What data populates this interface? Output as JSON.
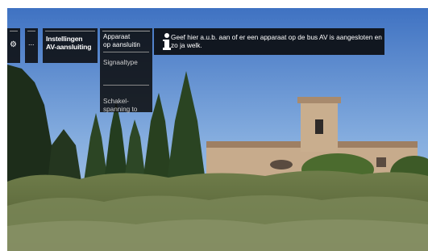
{
  "toolbar": {
    "gear_icon": "gear-icon",
    "more_label": "...",
    "title_line1": "Instellingen",
    "title_line2": "AV-aansluiting"
  },
  "menu": {
    "items": [
      {
        "label_line1": "Apparaat",
        "label_line2": "op aansluitin",
        "selected": true
      },
      {
        "label_line1": "Signaaltype",
        "label_line2": "",
        "selected": false
      },
      {
        "label_line1": "Schakel-",
        "label_line2": "spanning to",
        "selected": false
      }
    ]
  },
  "info": {
    "icon": "info-icon",
    "text": "Geef hier a.u.b. aan of er een apparaat op de bus AV is aangesloten en zo ja welk."
  }
}
